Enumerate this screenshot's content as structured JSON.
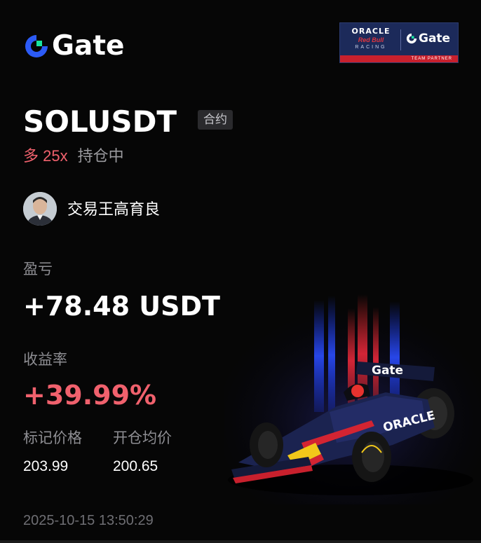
{
  "brand": {
    "name": "Gate",
    "colors": {
      "blue": "#2c5bf6",
      "green": "#17e5a0",
      "red": "#f0616d",
      "gray": "#8e8e93"
    }
  },
  "partner": {
    "oracle": "ORACLE",
    "redbull": "Red Bull",
    "racing": "RACING",
    "gate": "Gate",
    "strip": "TEAM PARTNER"
  },
  "position": {
    "pair": "SOLUSDT",
    "type_tag": "合约",
    "side": "多 25x",
    "status": "持仓中"
  },
  "trader": {
    "name": "交易王高育良",
    "avatar_icon": "avatar-photo"
  },
  "stats": {
    "pnl_label": "盈亏",
    "pnl_value": "+78.48 USDT",
    "roi_label": "收益率",
    "roi_value": "+39.99%",
    "mark_price_label": "标记价格",
    "mark_price_value": "203.99",
    "entry_price_label": "开仓均价",
    "entry_price_value": "200.65"
  },
  "timestamp": "2025-10-15 13:50:29",
  "car": {
    "wing_text": "Gate",
    "sidepod_text": "ORACLE"
  }
}
